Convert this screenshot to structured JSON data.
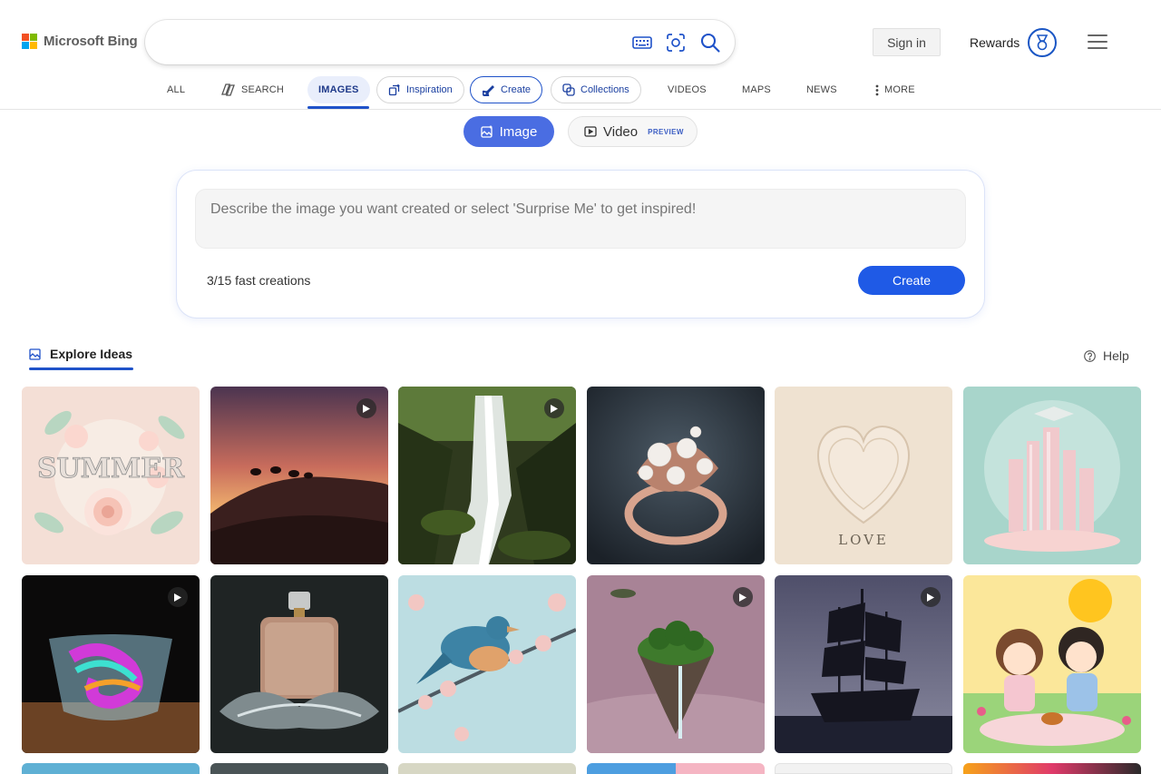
{
  "brand": {
    "logo_text": "Microsoft Bing"
  },
  "search": {
    "value": "",
    "placeholder": ""
  },
  "header": {
    "signin_label": "Sign in",
    "rewards_label": "Rewards"
  },
  "tabs": {
    "all": "ALL",
    "search": "SEARCH",
    "images": "IMAGES",
    "inspiration": "Inspiration",
    "create": "Create",
    "collections": "Collections",
    "videos": "VIDEOS",
    "maps": "MAPS",
    "news": "NEWS",
    "more": "MORE"
  },
  "mode": {
    "image_label": "Image",
    "video_label": "Video",
    "video_tag": "PREVIEW"
  },
  "creator": {
    "prompt_placeholder": "Describe the image you want created or select 'Surprise Me' to get inspired!",
    "prompt_value": "",
    "fast_creations": "3/15 fast creations",
    "create_label": "Create"
  },
  "explore": {
    "title": "Explore Ideas",
    "help_label": "Help"
  },
  "ideas": [
    {
      "icon": "summer-paper-flowers-image",
      "video": false
    },
    {
      "icon": "desert-camels-sunset-image",
      "video": true
    },
    {
      "icon": "forest-waterfall-image",
      "video": true
    },
    {
      "icon": "pearl-ring-image",
      "video": false
    },
    {
      "icon": "paper-heart-love-image",
      "video": false
    },
    {
      "icon": "pastel-city-graduation-image",
      "video": false
    },
    {
      "icon": "rainbow-glass-bowl-image",
      "video": true
    },
    {
      "icon": "perfume-bottle-splash-image",
      "video": false
    },
    {
      "icon": "bird-cherry-blossom-image",
      "video": false
    },
    {
      "icon": "floating-island-image",
      "video": true
    },
    {
      "icon": "ghost-ship-image",
      "video": true
    },
    {
      "icon": "chibi-couple-picnic-image",
      "video": false
    }
  ],
  "colors": {
    "accent": "#1f52c9",
    "create_button": "#1f5ae6",
    "image_pill": "#4a6de2"
  }
}
